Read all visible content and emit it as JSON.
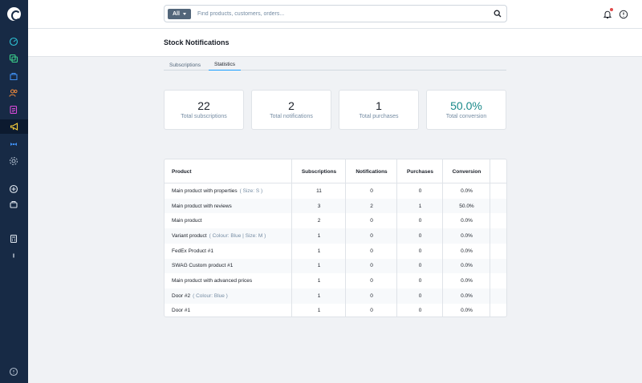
{
  "search": {
    "type_label": "All",
    "placeholder": "Find products, customers, orders..."
  },
  "page": {
    "title": "Stock Notifications"
  },
  "tabs": [
    {
      "label": "Subscriptions"
    },
    {
      "label": "Statistics"
    }
  ],
  "stats": [
    {
      "value": "22",
      "label": "Total subscriptions"
    },
    {
      "value": "2",
      "label": "Total notifications"
    },
    {
      "value": "1",
      "label": "Total purchases"
    },
    {
      "value": "50.0%",
      "label": "Total conversion"
    }
  ],
  "table": {
    "headers": [
      "Product",
      "Subscriptions",
      "Notifications",
      "Purchases",
      "Conversion"
    ],
    "rows": [
      {
        "product": "Main product with properties",
        "variant": "( Size: S )",
        "subscriptions": "11",
        "notifications": "0",
        "purchases": "0",
        "conversion": "0.0%"
      },
      {
        "product": "Main product with reviews",
        "variant": "",
        "subscriptions": "3",
        "notifications": "2",
        "purchases": "1",
        "conversion": "50.0%"
      },
      {
        "product": "Main product",
        "variant": "",
        "subscriptions": "2",
        "notifications": "0",
        "purchases": "0",
        "conversion": "0.0%"
      },
      {
        "product": "Variant product",
        "variant": "( Colour: Blue | Size: M )",
        "subscriptions": "1",
        "notifications": "0",
        "purchases": "0",
        "conversion": "0.0%"
      },
      {
        "product": "FedEx Product #1",
        "variant": "",
        "subscriptions": "1",
        "notifications": "0",
        "purchases": "0",
        "conversion": "0.0%"
      },
      {
        "product": "SWAG Custom product #1",
        "variant": "",
        "subscriptions": "1",
        "notifications": "0",
        "purchases": "0",
        "conversion": "0.0%"
      },
      {
        "product": "Main product with advanced prices",
        "variant": "",
        "subscriptions": "1",
        "notifications": "0",
        "purchases": "0",
        "conversion": "0.0%"
      },
      {
        "product": "Door #2",
        "variant": "( Colour: Blue )",
        "subscriptions": "1",
        "notifications": "0",
        "purchases": "0",
        "conversion": "0.0%"
      },
      {
        "product": "Door #1",
        "variant": "",
        "subscriptions": "1",
        "notifications": "0",
        "purchases": "0",
        "conversion": "0.0%"
      }
    ]
  },
  "colors": {
    "sidebar": "#172a45",
    "accent": "#189eff",
    "teal": "#1a8a8a",
    "notification_dot": "#e14b4b"
  },
  "icons": {
    "sidebar": [
      "shopware-logo-icon",
      "dashboard-icon",
      "catalog-icon",
      "orders-icon",
      "customers-icon",
      "content-icon",
      "marketing-icon",
      "extensions-icon",
      "settings-icon",
      "add-icon",
      "shop-icon",
      "calculator-icon",
      "info-icon",
      "help-circle-icon"
    ],
    "topbar": [
      "search-icon",
      "bell-icon",
      "help-icon"
    ]
  }
}
